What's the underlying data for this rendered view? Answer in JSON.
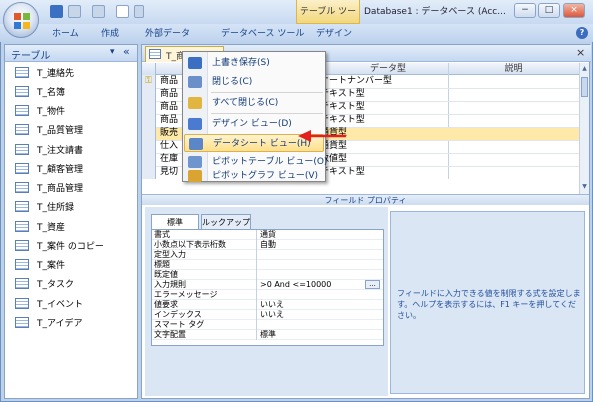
{
  "window": {
    "title": "Database1 : データベース (Acc...",
    "contextual_tab": "テーブル ツール",
    "minimize": "−",
    "maximize": "□",
    "close": "×"
  },
  "ribbon_tabs": [
    "ホーム",
    "作成",
    "外部データ",
    "データベース ツール",
    "デザイン"
  ],
  "help_label": "?",
  "nav": {
    "header": "テーブル",
    "header_dropdown": "▾",
    "header_collapse": "«",
    "items": [
      "T_連絡先",
      "T_名簿",
      "T_物件",
      "T_品質管理",
      "T_注文請書",
      "T_顧客管理",
      "T_商品管理",
      "T_住所録",
      "T_資産",
      "T_案件 のコピー",
      "T_案件",
      "T_タスク",
      "T_イベント",
      "T_アイデア"
    ]
  },
  "doc": {
    "tab_label": "T_商品管理",
    "close": "×"
  },
  "grid": {
    "headers": [
      "データ型",
      "説明"
    ],
    "rows": [
      {
        "field": "商品",
        "type": "オートナンバー型"
      },
      {
        "field": "商品",
        "type": "テキスト型"
      },
      {
        "field": "商品",
        "type": "テキスト型"
      },
      {
        "field": "商品",
        "type": "テキスト型"
      },
      {
        "field": "販売",
        "type": "通貨型"
      },
      {
        "field": "仕入",
        "type": "通貨型"
      },
      {
        "field": "在庫",
        "type": "数値型"
      },
      {
        "field": "見切",
        "type": "テキスト型"
      }
    ]
  },
  "field_properties": {
    "title": "フィールド プロパティ",
    "tabs": [
      "標準",
      "ルックアップ"
    ],
    "rows": [
      {
        "key": "書式",
        "value": "通貨"
      },
      {
        "key": "小数点以下表示桁数",
        "value": "自動"
      },
      {
        "key": "定型入力",
        "value": ""
      },
      {
        "key": "標題",
        "value": ""
      },
      {
        "key": "既定値",
        "value": ""
      },
      {
        "key": "入力規則",
        "value": ">0 And <=10000"
      },
      {
        "key": "エラーメッセージ",
        "value": ""
      },
      {
        "key": "値要求",
        "value": "いいえ"
      },
      {
        "key": "インデックス",
        "value": "いいえ"
      },
      {
        "key": "スマート タグ",
        "value": ""
      },
      {
        "key": "文字配置",
        "value": "標準"
      }
    ],
    "builder_button": "...",
    "help_text": "フィールドに入力できる値を制限する式を設定します。ヘルプを表示するには、F1 キーを押してください。"
  },
  "context_menu": {
    "items": [
      {
        "label": "上書き保存(S)",
        "icon": "save-icon",
        "color": "#3a6fc4"
      },
      {
        "label": "閉じる(C)",
        "icon": "close-doc-icon",
        "color": "#6b8fc9"
      },
      {
        "label": "すべて閉じる(C)",
        "icon": "folder-icon",
        "color": "#e1b640"
      },
      {
        "label": "デザイン ビュー(D)",
        "icon": "design-view-icon",
        "color": "#4a7bd0"
      },
      {
        "label": "データシート ビュー(H)",
        "icon": "datasheet-view-icon",
        "color": "#5b86c8"
      },
      {
        "label": "ピボットテーブル ビュー(O)",
        "icon": "pivot-table-icon",
        "color": "#6f95cf"
      },
      {
        "label": "ピボットグラフ ビュー(V)",
        "icon": "pivot-chart-icon",
        "color": "#d9a431"
      }
    ],
    "highlighted_index": 4
  },
  "colors": {
    "accent_arrow": "#e2201c",
    "ribbon_text": "#15428b",
    "highlight": "#ffdf8a"
  }
}
